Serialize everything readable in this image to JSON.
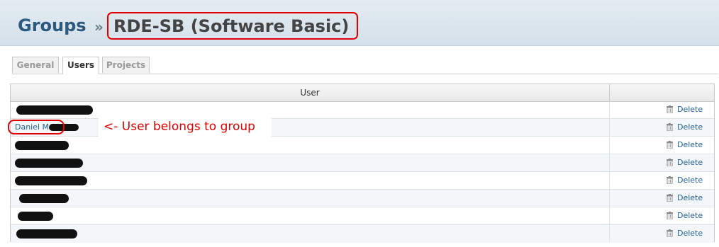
{
  "header": {
    "root": "Groups",
    "separator": "»",
    "title": "RDE-SB (Software Basic)"
  },
  "tabs": [
    {
      "label": "General",
      "active": false
    },
    {
      "label": "Users",
      "active": true
    },
    {
      "label": "Projects",
      "active": false
    }
  ],
  "table": {
    "user_header": "User",
    "rows": [
      {
        "user": "",
        "redacted": true,
        "delete": "Delete"
      },
      {
        "user": "Daniel M",
        "redacted": true,
        "delete": "Delete"
      },
      {
        "user": "",
        "redacted": true,
        "delete": "Delete"
      },
      {
        "user": "",
        "redacted": true,
        "delete": "Delete"
      },
      {
        "user": "",
        "redacted": true,
        "delete": "Delete"
      },
      {
        "user": "",
        "redacted": true,
        "delete": "Delete"
      },
      {
        "user": "",
        "redacted": true,
        "delete": "Delete"
      },
      {
        "user": "",
        "redacted": true,
        "delete": "Delete"
      }
    ]
  },
  "annotation": {
    "text": "<- User belongs to group",
    "color": "#e00000"
  },
  "colors": {
    "link": "#1f5f99",
    "header_title": "#2a5a80"
  }
}
